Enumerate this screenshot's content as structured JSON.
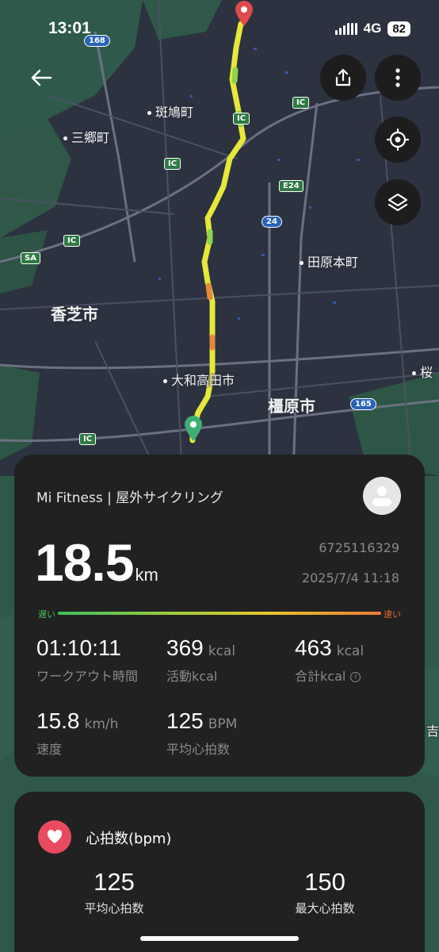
{
  "status_bar": {
    "time": "13:01",
    "network": "4G",
    "battery": "82"
  },
  "map": {
    "labels": {
      "ikaruga": "斑鳩町",
      "sango": "三郷町",
      "tawaramoto": "田原本町",
      "kashiba": "香芝市",
      "yamatotakada": "大和高田市",
      "kashihara": "橿原市",
      "sakura": "桜",
      "yoshi": "吉"
    },
    "road_badges": {
      "r168": "168",
      "ic": "IC",
      "e24": "E24",
      "r24": "24",
      "r165": "165",
      "sa": "SA"
    },
    "route_colors": {
      "main": "#e6e83a",
      "fast": "#8ed34a",
      "slow": "#e38a3a"
    }
  },
  "activity": {
    "app_title": "Mi Fitness | 屋外サイクリング",
    "distance_value": "18.5",
    "distance_unit": "km",
    "record_id": "6725116329",
    "record_date": "2025/7/4 11:18",
    "speed_slow_label": "遅い",
    "speed_fast_label": "速い",
    "metrics": {
      "workout_time": {
        "value": "01:10:11",
        "unit": "",
        "label": "ワークアウト時間"
      },
      "active_kcal": {
        "value": "369",
        "unit": "kcal",
        "label": "活動kcal"
      },
      "total_kcal": {
        "value": "463",
        "unit": "kcal",
        "label": "合計kcal"
      },
      "speed": {
        "value": "15.8",
        "unit": "km/h",
        "label": "速度"
      },
      "avg_hr": {
        "value": "125",
        "unit": "BPM",
        "label": "平均心拍数"
      }
    }
  },
  "heart_rate": {
    "title": "心拍数(bpm)",
    "avg_value": "125",
    "avg_label": "平均心拍数",
    "max_value": "150",
    "max_label": "最大心拍数",
    "accent": "#e84b5f"
  }
}
